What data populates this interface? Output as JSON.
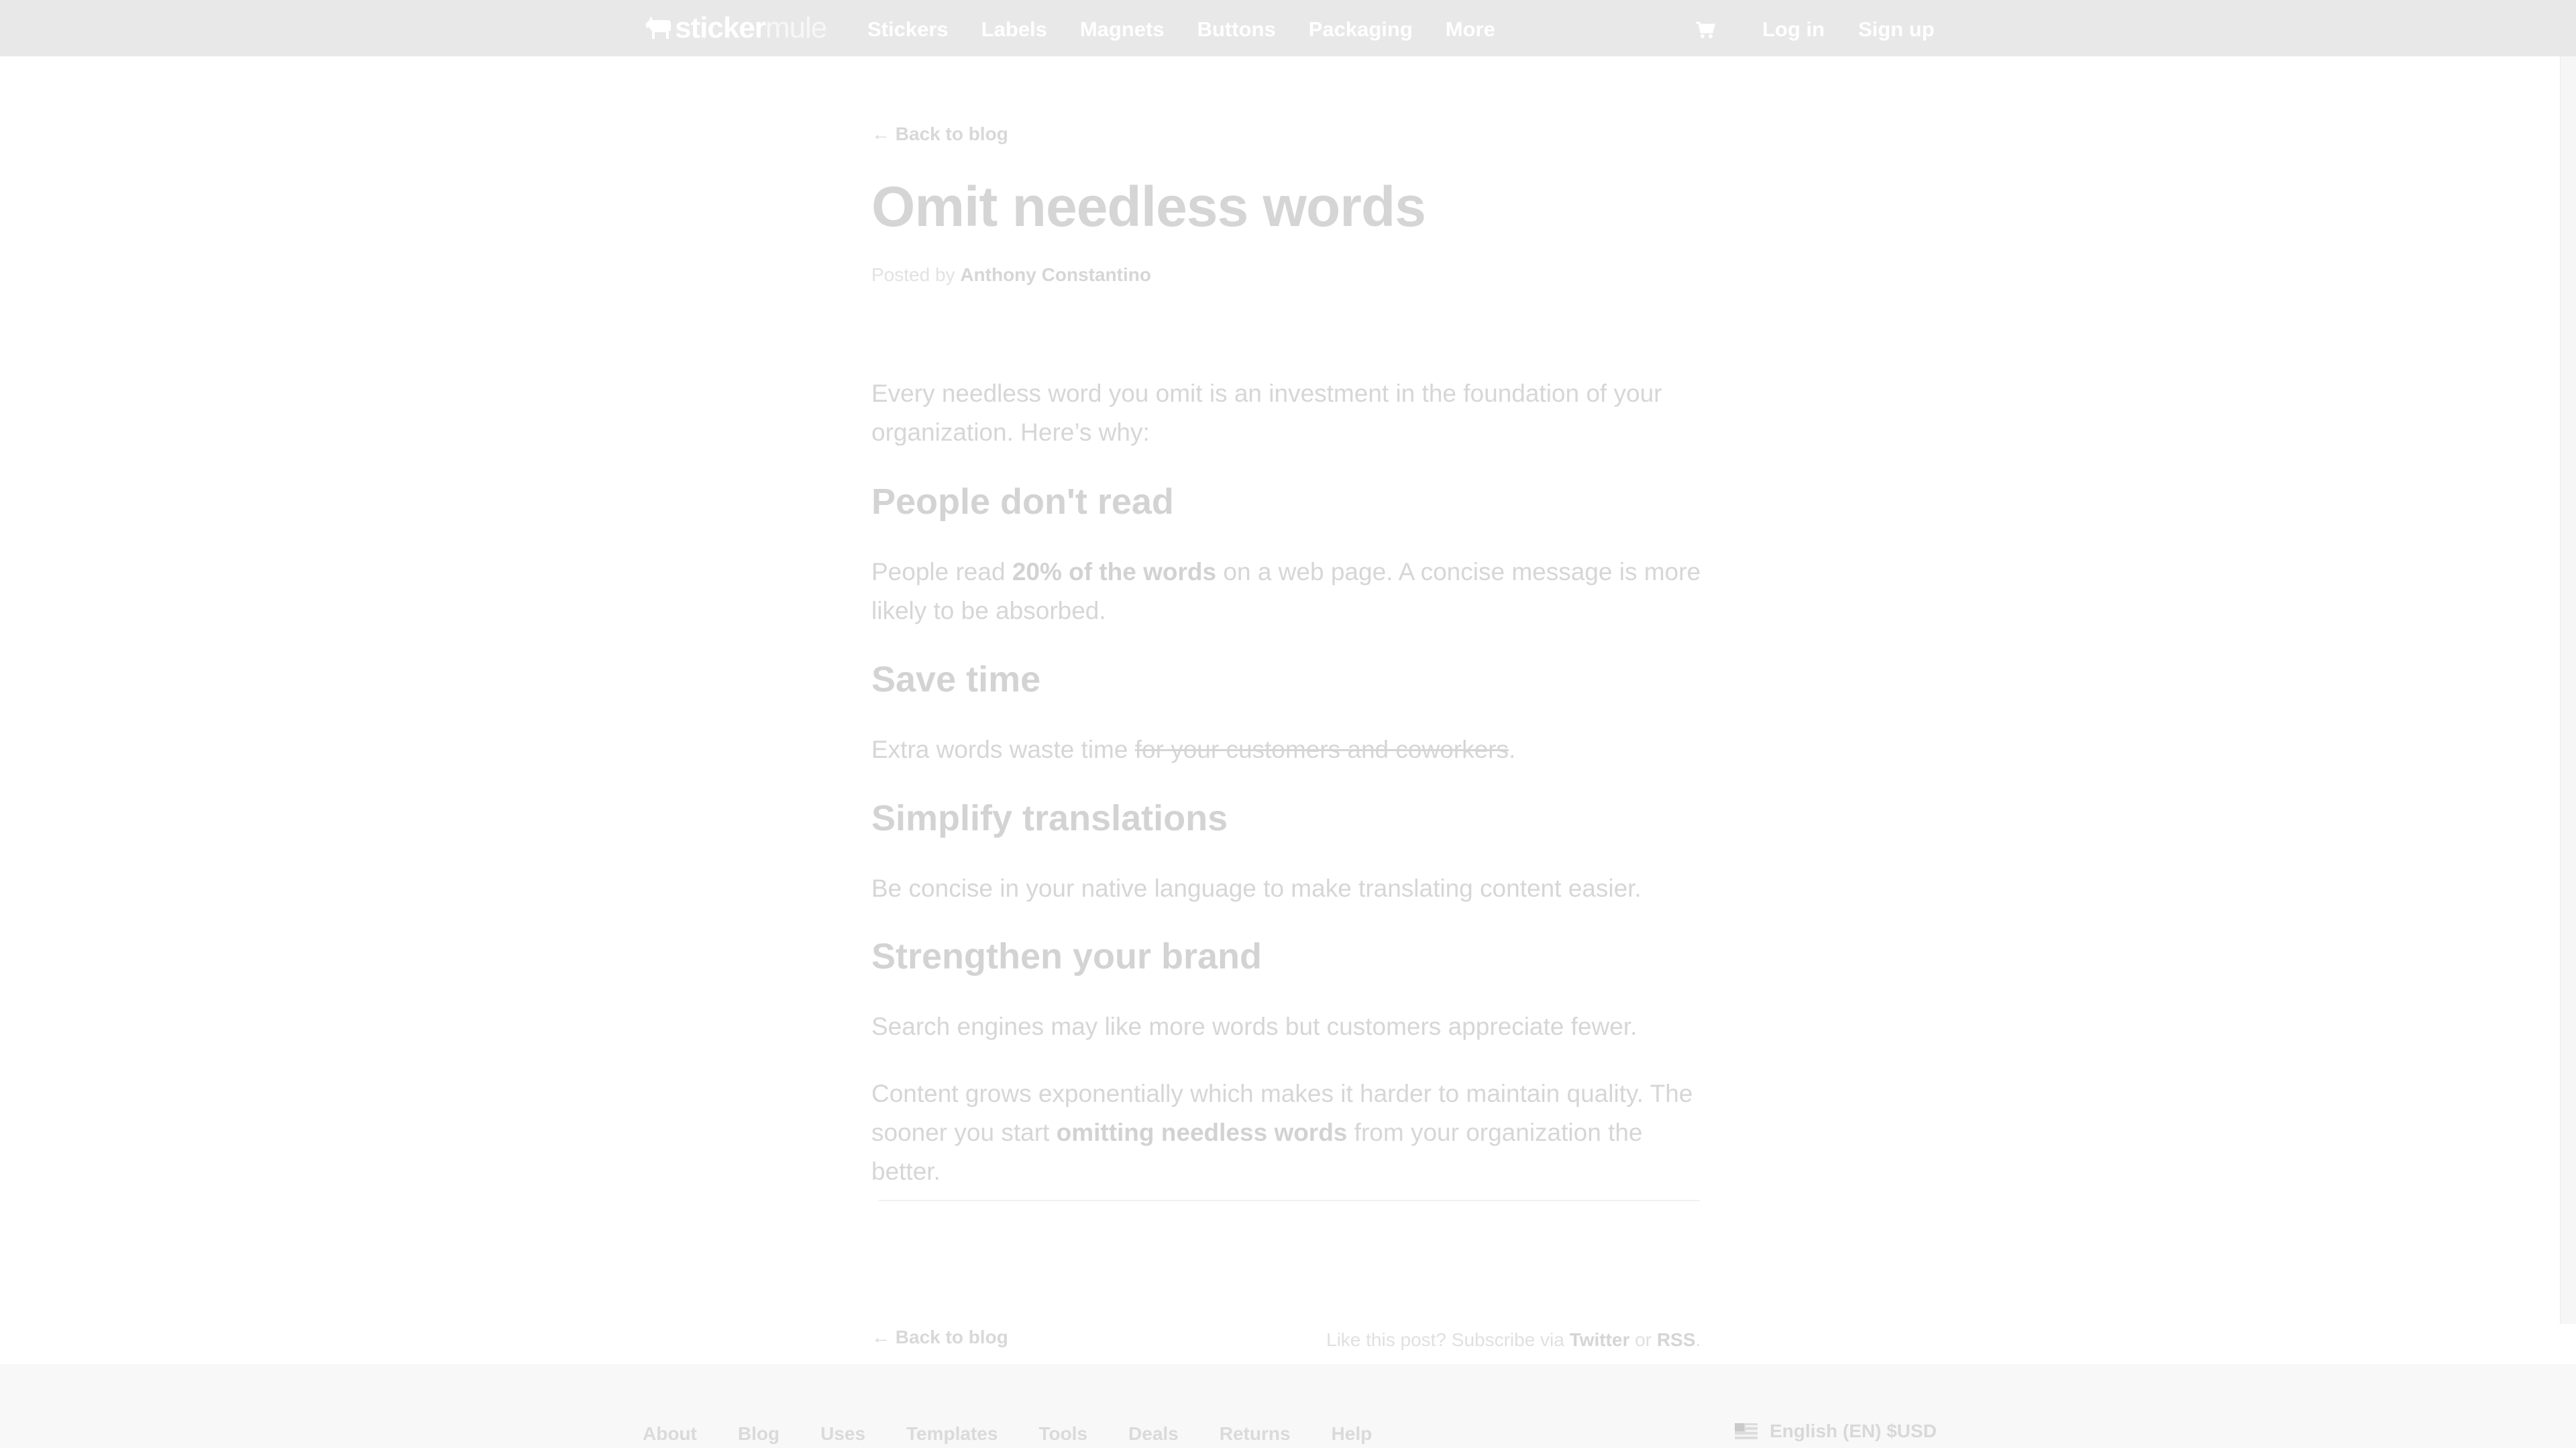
{
  "header": {
    "logo_bold": "sticker",
    "logo_thin": "mule",
    "nav": [
      "Stickers",
      "Labels",
      "Magnets",
      "Buttons",
      "Packaging",
      "More"
    ],
    "cart_icon": "shopping-cart-icon",
    "login": "Log in",
    "signup": "Sign up"
  },
  "article": {
    "back_link": "← Back to blog",
    "title": "Omit needless words",
    "byline_prefix": "Posted by ",
    "author": "Anthony Constantino",
    "intro": "Every needless word you omit is an investment in the foundation of your organization. Here’s why:",
    "sections": [
      {
        "heading": "People don't read",
        "text_before": "People read ",
        "text_emph": "20% of the words",
        "text_after": " on a web page. A concise message is more likely to be absorbed."
      },
      {
        "heading": "Save time",
        "text_before": "Extra words waste time ",
        "text_strike": "for your customers and coworkers",
        "text_after": "."
      },
      {
        "heading": "Simplify translations",
        "text": "Be concise in your native language to make translating content easier."
      },
      {
        "heading": "Strengthen your brand",
        "text": "Search engines may like more words but customers appreciate fewer."
      }
    ],
    "closing_before": "Content grows exponentially which makes it harder to maintain quality. The sooner you start ",
    "closing_emph": "omitting needless words",
    "closing_after": " from your organization the better.",
    "subscribe_prefix": "Like this post? Subscribe via ",
    "subscribe_twitter": "Twitter",
    "subscribe_or": " or ",
    "subscribe_rss": "RSS",
    "subscribe_suffix": "."
  },
  "footer": {
    "links": [
      "About",
      "Blog",
      "Uses",
      "Templates",
      "Tools",
      "Deals",
      "Returns",
      "Help"
    ],
    "locale": "English (EN) $USD",
    "locale_icon": "flag-icon"
  }
}
